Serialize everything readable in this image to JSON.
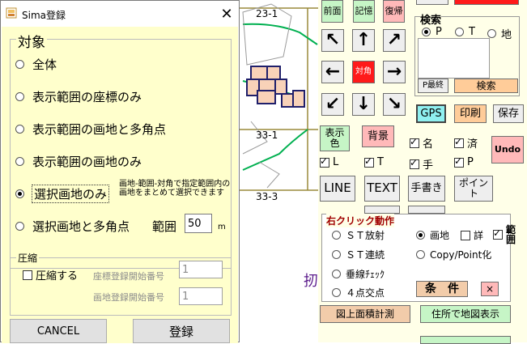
{
  "map": {
    "labels": [
      "23-1",
      "33-1",
      "33-3",
      "扨"
    ]
  },
  "panel": {
    "nav_buttons": {
      "front": "前面",
      "memory": "記憶",
      "restore": "復帰",
      "diagonal": "対角"
    },
    "search": {
      "title": "検索",
      "radio_p": "P",
      "radio_t": "T",
      "radio_land": "地",
      "last_p_button": "P最終",
      "search_button": "検索"
    },
    "gps": "GPS",
    "print": "印刷",
    "save": "保存",
    "display_color": "表示色",
    "background": "背景",
    "undo": "Undo",
    "checks": {
      "name": "名",
      "extinct": "済",
      "l": "L",
      "t": "T",
      "hand": "手",
      "p": "P"
    },
    "line_button": "LINE",
    "text_button": "TEXT",
    "handwrite_button": "手書き",
    "point_button": "ポイント",
    "right_click": {
      "title": "右クリック動作",
      "st_radiate": "ＳＴ放射",
      "parcel": "画地",
      "detail": "詳",
      "range": "範囲",
      "st_connect": "ＳＴ連続",
      "copy_point": "Copy/Point化",
      "perpendicular": "垂線ﾁｪｯｸ",
      "four_point": "４点交点",
      "condition": "条　件",
      "close": "×"
    },
    "area_measure": "図上面積計測",
    "address_map": "住所で地図表示"
  },
  "dialog": {
    "title": "Sima登録",
    "target_legend": "対象",
    "options": [
      "全体",
      "表示範囲の座標のみ",
      "表示範囲の画地と多角点",
      "表示範囲の画地のみ",
      "選択画地のみ",
      "選択画地と多角点"
    ],
    "selected_option_index": 4,
    "note": "画地-範囲-対角で指定範囲内の画地をまとめて選択できます",
    "range_label": "範囲",
    "range_value": "50",
    "range_unit": "m",
    "compress_legend": "圧縮",
    "compress_check": "圧縮する",
    "coord_start_label": "座標登録開始番号",
    "coord_start_value": "1",
    "parcel_start_label": "画地登録開始番号",
    "parcel_start_value": "1",
    "cancel": "CANCEL",
    "register": "登録"
  }
}
